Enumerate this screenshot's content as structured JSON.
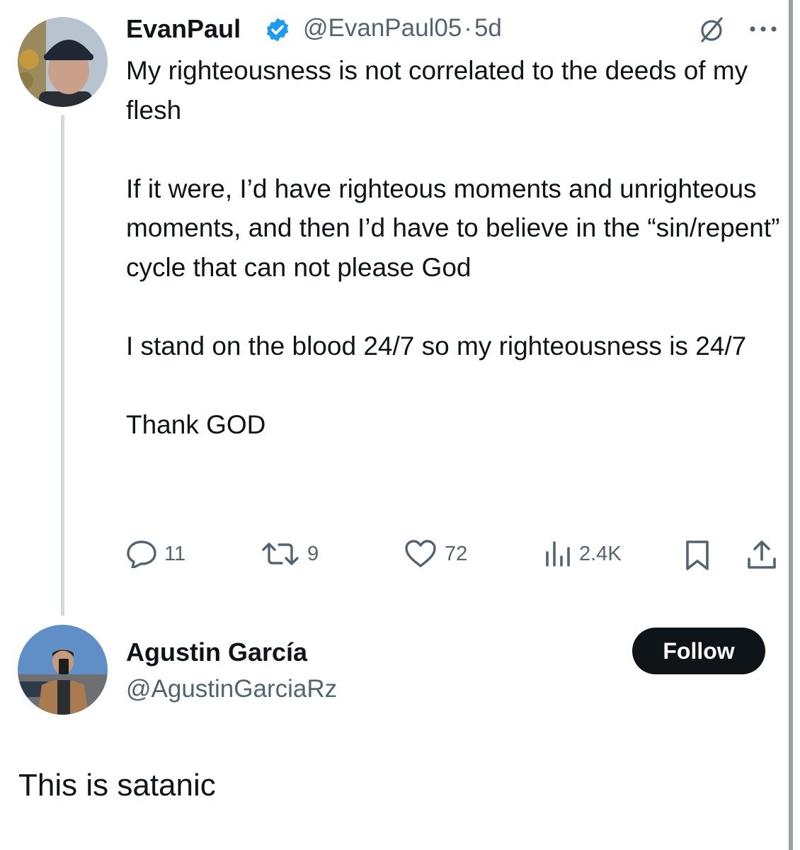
{
  "tweet": {
    "author_name": "EvanPaul",
    "verified": true,
    "handle": "@EvanPaul05",
    "separator": "·",
    "time": "5d",
    "paragraphs": [
      "My righteousness is not correlated to the deeds of my flesh",
      "If it were, I’d have righteous moments and unrighteous moments, and then I’d have to believe in the “sin/repent” cycle that can not please God",
      "I stand on the blood 24/7 so my righteousness is 24/7",
      "Thank GOD"
    ],
    "stats": {
      "replies": "11",
      "reposts": "9",
      "likes": "72",
      "views": "2.4K"
    }
  },
  "reply": {
    "author_name": "Agustin García",
    "handle": "@AgustinGarciaRz",
    "follow_label": "Follow",
    "text": "This is satanic"
  },
  "icons": {
    "verified": "verified-badge-icon",
    "grok": "grok-icon",
    "more": "more-icon",
    "reply": "reply-icon",
    "repost": "repost-icon",
    "like": "like-icon",
    "views": "views-icon",
    "bookmark": "bookmark-icon",
    "share": "share-icon"
  },
  "colors": {
    "text": "#0f1419",
    "secondary": "#536471",
    "verified_blue": "#1d9bf0",
    "thread_line": "#cfd9de",
    "button_bg": "#0f1419"
  }
}
